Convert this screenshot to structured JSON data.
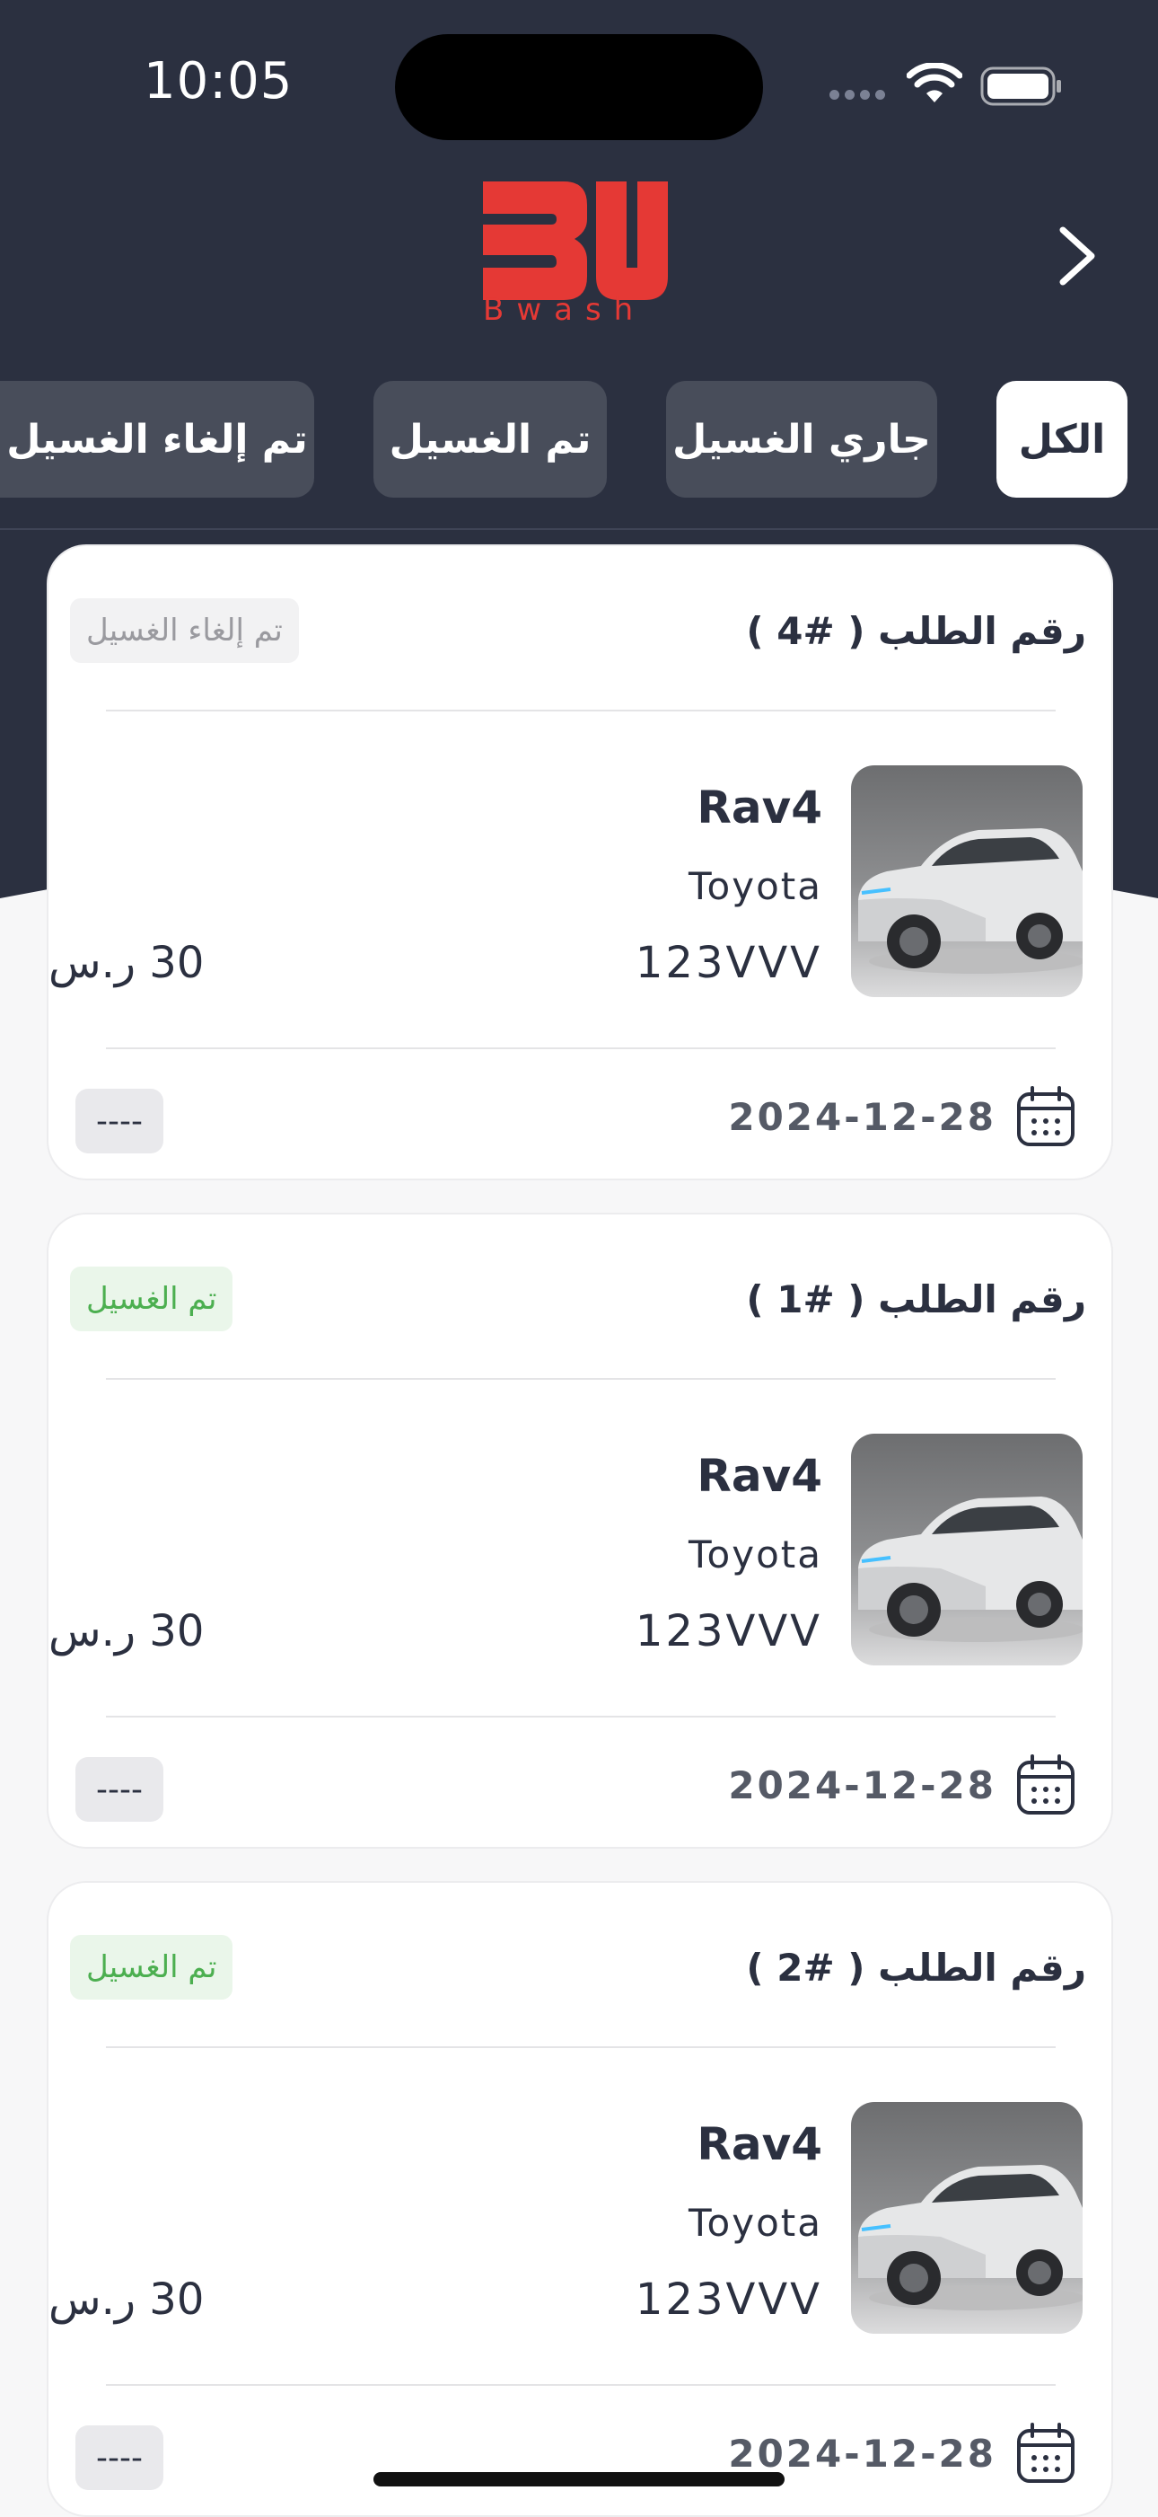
{
  "status_bar": {
    "time": "10:05"
  },
  "brand": {
    "logo_letters": "BW",
    "name": "Bwash",
    "color": "#e53935"
  },
  "tabs": [
    {
      "label": "الكل",
      "active": true
    },
    {
      "label": "جاري الغسيل",
      "active": false
    },
    {
      "label": "تم الغسيل",
      "active": false
    },
    {
      "label": "تم إلغاء الغسيل",
      "active": false
    }
  ],
  "orders": [
    {
      "title": "رقم الطلب ( #4 )",
      "status": "تم إلغاء الغسيل",
      "status_type": "cancelled",
      "model": "Rav4",
      "make": "Toyota",
      "plate": "123VVV",
      "price": "30 ر.س",
      "date": "2024-12-28",
      "note": "----"
    },
    {
      "title": "رقم الطلب ( #1 )",
      "status": "تم الغسيل",
      "status_type": "done",
      "model": "Rav4",
      "make": "Toyota",
      "plate": "123VVV",
      "price": "30 ر.س",
      "date": "2024-12-28",
      "note": "----"
    },
    {
      "title": "رقم الطلب ( #2 )",
      "status": "تم الغسيل",
      "status_type": "done",
      "model": "Rav4",
      "make": "Toyota",
      "plate": "123VVV",
      "price": "30 ر.س",
      "date": "2024-12-28",
      "note": "----"
    }
  ],
  "colors": {
    "header": "#2b3040",
    "tab_inactive": "#484d5a",
    "done_green": "#4caf50",
    "cancel_gray": "#9a9a9f"
  }
}
